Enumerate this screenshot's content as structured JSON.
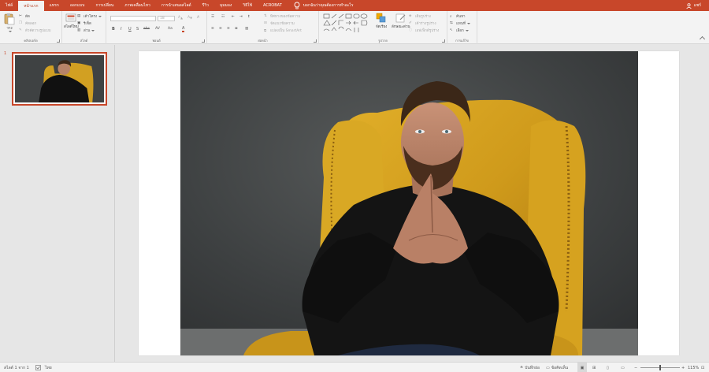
{
  "tabs": [
    "ไฟล์",
    "หน้าแรก",
    "แทรก",
    "ออกแบบ",
    "การเปลี่ยน",
    "ภาพเคลื่อนไหว",
    "การนำเสนอสไลด์",
    "รีวิว",
    "มุมมอง",
    "วิธีใช้",
    "ACROBAT"
  ],
  "active_tab": "หน้าแรก",
  "tell_me": "บอกฉันว่าคุณต้องการทำอะไร",
  "account": "แชร์",
  "ribbon": {
    "clipboard": {
      "label": "คลิปบอร์ด",
      "paste": "วาง",
      "cut": "ตัด",
      "copy": "คัดลอก",
      "format_painter": "ตัวคัดวางรูปแบบ"
    },
    "slides": {
      "label": "สไลด์",
      "new_slide": "สไลด์ใหม่",
      "layout": "เค้าโครง",
      "reset": "รีเซ็ต",
      "section": "ส่วน"
    },
    "font": {
      "label": "ฟอนต์",
      "font_size": "18",
      "buttons": [
        "B",
        "I",
        "U",
        "S",
        "abc",
        "AV",
        "Aa",
        "A"
      ]
    },
    "paragraph": {
      "label": "ย่อหน้า",
      "text_direction": "ทิศทางของข้อความ",
      "align_text": "จัดแนวข้อความ",
      "smartart": "แปลงเป็น SmartArt"
    },
    "drawing": {
      "label": "รูปวาด",
      "arrange": "จัดเรียง",
      "quick_styles": "ลักษณะด่วน",
      "shape_fill": "เติมรูปร่าง",
      "shape_outline": "เค้าร่างรูปร่าง",
      "shape_effects": "เอฟเฟ็กต์รูปร่าง"
    },
    "editing": {
      "label": "การแก้ไข",
      "find": "ค้นหา",
      "replace": "แทนที่",
      "select": "เลือก"
    }
  },
  "thumbnail": {
    "number": "1"
  },
  "statusbar": {
    "slide_info": "สไลด์ 1 จาก 1",
    "language": "ไทย",
    "notes": "บันทึกย่อ",
    "comments": "ข้อคิดเห็น",
    "zoom": "115%"
  },
  "colors": {
    "accent": "#c8472a",
    "ribbon": "#f3f3f3",
    "workspace": "#e6e6e6"
  }
}
